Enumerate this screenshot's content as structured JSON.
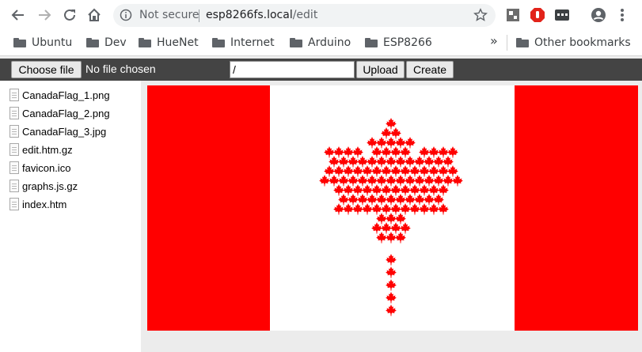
{
  "browser": {
    "security_label": "Not secure",
    "url_host": "esp8266fs.local",
    "url_path": "/edit",
    "bookmarks": [
      "Ubuntu",
      "Dev",
      "HueNet",
      "Internet",
      "Arduino",
      "ESP8266"
    ],
    "overflow_label": "»",
    "other_bookmarks": "Other bookmarks"
  },
  "upload_bar": {
    "choose_file_label": "Choose file",
    "no_file_label": "No file chosen",
    "path_value": "/",
    "upload_label": "Upload",
    "create_label": "Create"
  },
  "files": [
    "CanadaFlag_1.png",
    "CanadaFlag_2.png",
    "CanadaFlag_3.jpg",
    "edit.htm.gz",
    "favicon.ico",
    "graphs.js.gz",
    "index.htm"
  ],
  "colors": {
    "flag_red": "#ff0000",
    "toolbar_dark": "#444444",
    "icon_gray": "#5f6368"
  }
}
